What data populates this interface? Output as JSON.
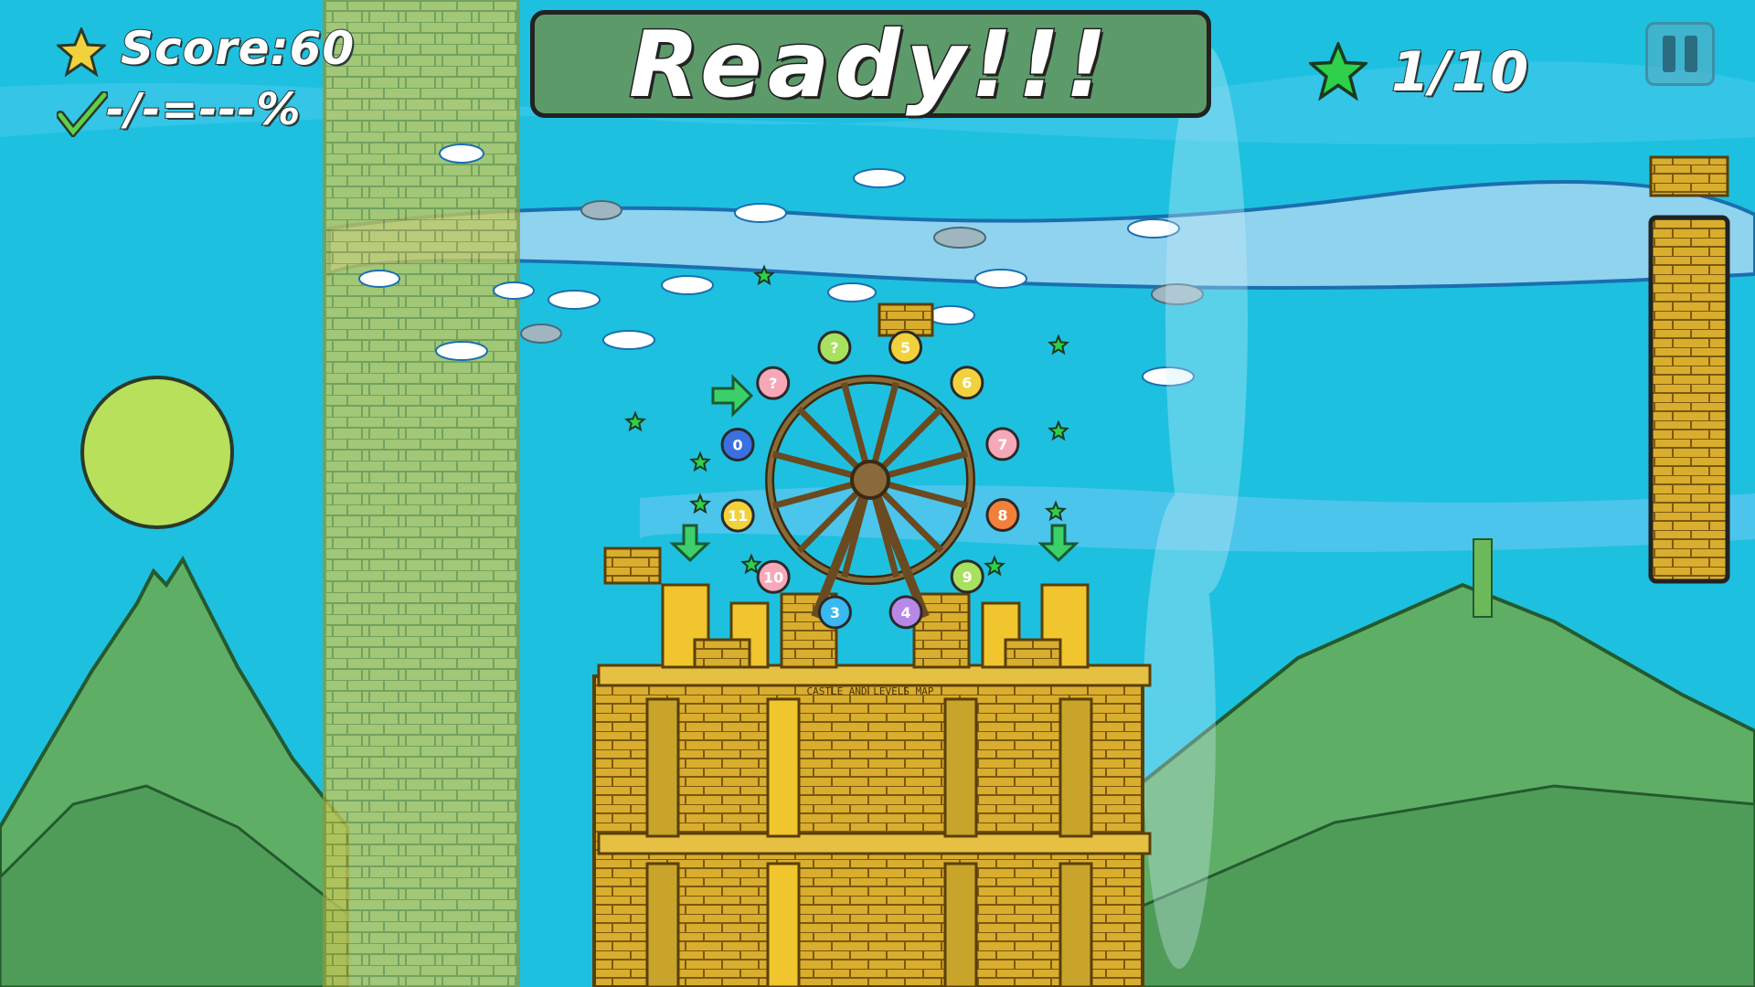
{
  "hud": {
    "score_label": "Score:60",
    "progress_label": "-/-=---%",
    "stars_collected": "1/10",
    "banner_text": "Ready!!!",
    "pause_icon": "pause-icon"
  },
  "scene": {
    "wheel_numbers": [
      "5",
      "6",
      "7",
      "8",
      "9",
      "4",
      "3",
      "10",
      "11",
      "0",
      "?",
      "?"
    ],
    "temple_sign": "CASTLE AND LEVELS MAP",
    "colors": {
      "sky": "#1ec0e0",
      "hills": "#5fae66",
      "sun": "#b8e05a",
      "bricks": "#d9ad2e",
      "banner": "#5d9a6a",
      "star_yellow": "#f2d23c",
      "star_green": "#2fd04a"
    }
  }
}
